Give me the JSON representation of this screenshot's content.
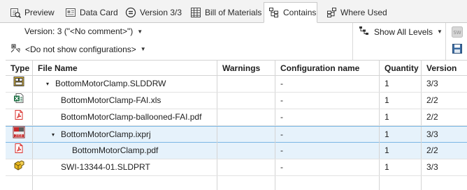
{
  "tabs": [
    {
      "label": "Preview",
      "icon": "preview-icon"
    },
    {
      "label": "Data Card",
      "icon": "data-card-icon"
    },
    {
      "label": "Version 3/3",
      "icon": "version-icon"
    },
    {
      "label": "Bill of Materials",
      "icon": "bom-icon"
    },
    {
      "label": "Contains",
      "icon": "contains-icon",
      "active": true
    },
    {
      "label": "Where Used",
      "icon": "where-used-icon"
    }
  ],
  "toolbar": {
    "version_label": "Version: 3 (\"<No comment>\")",
    "config_label": "<Do not show configurations>",
    "levels_label": "Show All Levels"
  },
  "columns": {
    "type": "Type",
    "file_name": "File Name",
    "warnings": "Warnings",
    "configuration": "Configuration name",
    "quantity": "Quantity",
    "version": "Version"
  },
  "rows": [
    {
      "icon": "solidworks-drawing-icon",
      "indent": 0,
      "expander": "▾",
      "file_name": "BottomMotorClamp.SLDDRW",
      "warnings": "",
      "configuration": "-",
      "quantity": "1",
      "version": "3/3",
      "selected": false
    },
    {
      "icon": "excel-file-icon",
      "indent": 1,
      "expander": "",
      "file_name": "BottomMotorClamp-FAI.xls",
      "warnings": "",
      "configuration": "-",
      "quantity": "1",
      "version": "2/2",
      "selected": false
    },
    {
      "icon": "pdf-file-icon",
      "indent": 1,
      "expander": "",
      "file_name": "BottomMotorClamp-ballooned-FAI.pdf",
      "warnings": "",
      "configuration": "-",
      "quantity": "1",
      "version": "2/2",
      "selected": false
    },
    {
      "icon": "inspection-project-icon",
      "indent": 1,
      "expander": "▾",
      "file_name": "BottomMotorClamp.ixprj",
      "warnings": "",
      "configuration": "-",
      "quantity": "1",
      "version": "3/3",
      "selected": true
    },
    {
      "icon": "pdf-file-icon",
      "indent": 2,
      "expander": "",
      "file_name": "BottomMotorClamp.pdf",
      "warnings": "",
      "configuration": "-",
      "quantity": "1",
      "version": "2/2",
      "selected": true
    },
    {
      "icon": "solidworks-part-icon",
      "indent": 1,
      "expander": "",
      "file_name": "SWI-13344-01.SLDPRT",
      "warnings": "",
      "configuration": "-",
      "quantity": "1",
      "version": "3/3",
      "selected": false
    }
  ],
  "colors": {
    "selection": "#e6f2fb",
    "selection_border": "#7ab6e4",
    "tabbar": "#f3f3f3",
    "pdf_red": "#d9302c",
    "excel_green": "#1e7145"
  }
}
